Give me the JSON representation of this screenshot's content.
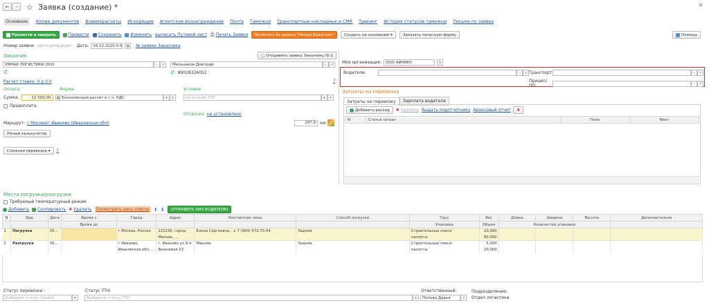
{
  "window": {
    "title": "Заявка (создание) *"
  },
  "tabs": [
    "Основное",
    "Копии документов",
    "Взаиморасчеты",
    "Исходящие",
    "Агентское вознаграждение",
    "Почта",
    "Таможня",
    "Транспортные накладные и CMR",
    "Трекинг",
    "История статусов таможни",
    "Письма по заявке"
  ],
  "toolbar": {
    "post_close": "Провести и закрыть",
    "post": "Провести",
    "save": "Сохранить",
    "change": "Изменить",
    "waybill": "выписать Путевой лист",
    "print": "Печать Заявки",
    "smart_driver": "Включить Из режим \"Умный Водитель\"",
    "create_basis": "Создать на основании",
    "order_form": "Заказать печатную форму",
    "help": "Помощь"
  },
  "header": {
    "number_label": "Номер заявки:",
    "number_placeholder": "автонумерация",
    "date_label": "Дата:",
    "date_value": "04.12.2020 0:0",
    "client_number_link": "№ заявки Заказчика"
  },
  "customer": {
    "section_title": "Заказчик",
    "send_button": "Отправить заявку Заказчику ID 2",
    "name": "УМНАЯ ЛОГИСТИКА ООО",
    "contact": "Мельников Дмитрий",
    "phone": "89028326052",
    "rate_link": "Расчет ставки: 0 р 0.0"
  },
  "payment": {
    "pay_label": "Оплата",
    "form_label": "Форма",
    "condition_label": "Условие",
    "sum_label": "Сумма:",
    "sum_value": "12 500,00",
    "form_value": "Безналичный расчет в т.ч. НДС",
    "condition_placeholder": "по копиям ТТН",
    "prepay_label": "Предоплата",
    "delay_label": "Отсрочка",
    "delay_value": "не установлено"
  },
  "route": {
    "label": "Маршрут:",
    "value": "г Москва/г Иваново (Ивановская обл)",
    "km": "297,9",
    "km_unit": "км",
    "calculator_button": "Умный калькулятор",
    "complex_button": "Сложная перевозка"
  },
  "right": {
    "org_label": "Моя организация:",
    "org_value": "ООО АЙНИКС",
    "drivers_label": "Водители:",
    "transport_label": "Транспорт:",
    "trailer_label": "Прицеп/ПП:",
    "costs_title": "Затраты на перевозку",
    "costs_tabs": [
      "Затраты на перевозку",
      "Зарплата водителя"
    ],
    "add_expense": "Добавить расход",
    "delete": "Удалить",
    "issue_accountable": "Выдать подотчетнику",
    "advance_report": "Авансовый отчет",
    "costs_columns": [
      "N",
      "Статья затрат",
      "План",
      "Факт"
    ]
  },
  "loading": {
    "title": "Места погрузки/разгрузки",
    "temp_mode": "Требуемый температурный режим",
    "add": "Добавить",
    "copy": "Скопировать",
    "delete": "Удалить",
    "view_all": "Посмотреть весь список",
    "sms": "ОТПРАВИТЬ SMS ВОДИТЕЛЮ",
    "columns": [
      "N",
      "Вид",
      "Дата",
      "Время с",
      "Город",
      "Адрес",
      "Контактное лицо",
      "Способ погрузки",
      "Груз",
      "Вес",
      "Длина",
      "Ширина",
      "Высота",
      "Дополнительно"
    ],
    "subcolumns": {
      "time_to": "Время до",
      "packing": "Упаковка",
      "volume": "Объем",
      "pack_count": "Количество упаковки"
    },
    "rows": [
      {
        "n": "1",
        "kind": "Погрузка",
        "date": "05...",
        "city": "г Москва, Россия",
        "address1": "115230, город",
        "address2": "Москва, ...",
        "contact": "Елена Сергеевна , + 7 (964) 572-75-54",
        "method": "Задняя",
        "cargo": "Строительные смеси",
        "packing": "паллеты",
        "weight": "20,000",
        "volume": "80,000"
      },
      {
        "n": "2",
        "kind": "Разгрузка",
        "date": "06...",
        "city": "г Иваново,",
        "city2": "Ивановская обл, ...",
        "address1": "г. Иваново ул 9-я",
        "address2": "Вишневая 23",
        "contact": "Максим",
        "method": "Задняя",
        "cargo": "Строительные смеси",
        "packing": "паллеты",
        "weight": "5,000",
        "volume": "20,000"
      }
    ]
  },
  "footer": {
    "status_label": "Статус перевозки :",
    "status_placeholder": "Выберите статус Заявки",
    "ttn_label": "Статус ТТН:",
    "ttn_placeholder": "Выберите статус ТТН",
    "responsible_label": "Ответственный:",
    "responsible_value": "Попова Дарья",
    "division_label": "Подразделение:",
    "division_value": "Отдел логистики"
  },
  "colors": {
    "accent_green": "#34a853",
    "orange": "#ef7d22",
    "highlight_row": "#fbf5cf",
    "red_frame": "#d63030"
  }
}
